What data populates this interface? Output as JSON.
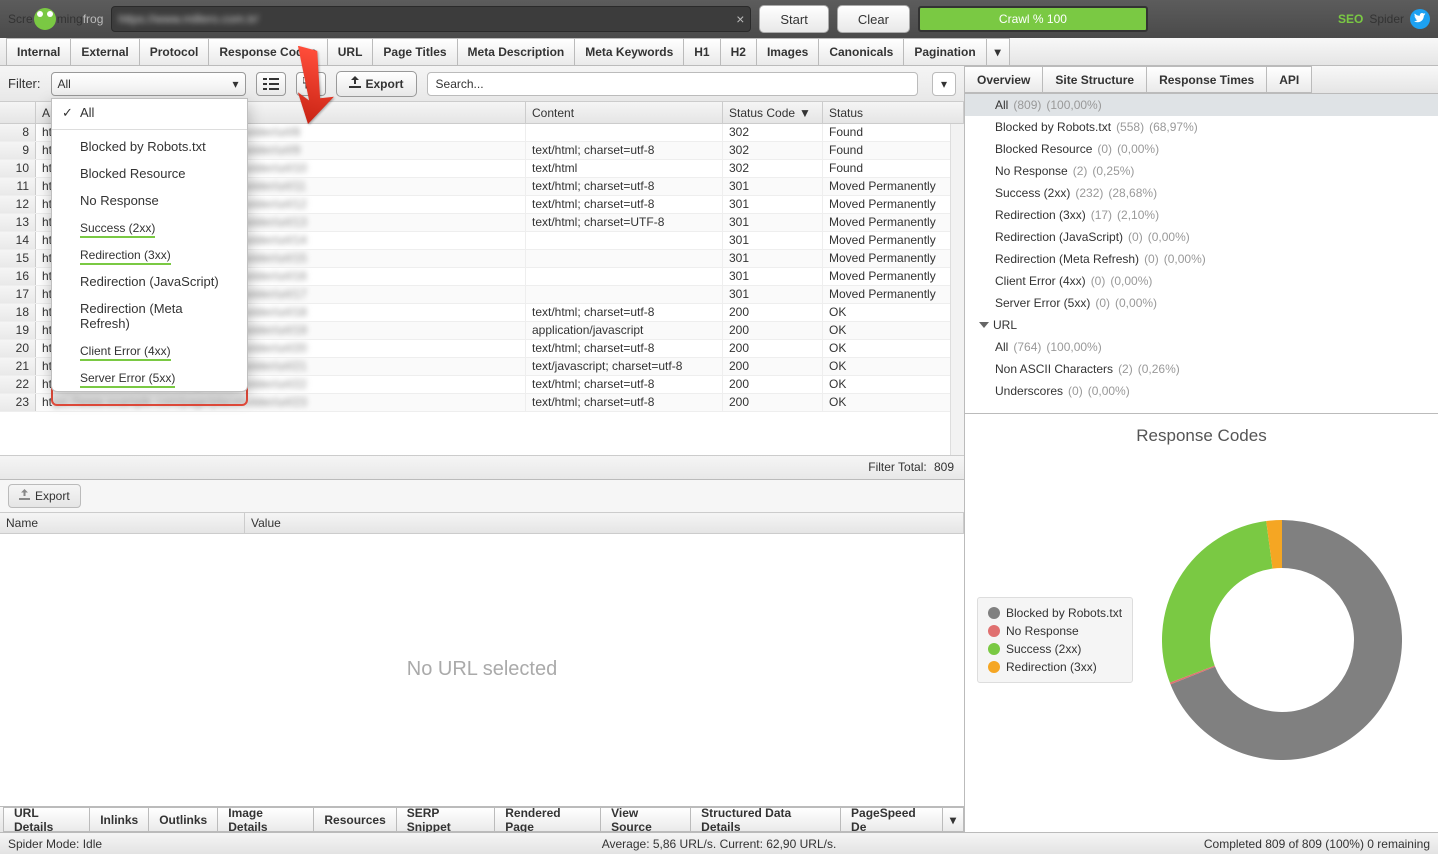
{
  "logo": {
    "pre": "Scre",
    "post": "ming",
    "tail": "frog"
  },
  "seo_spider": {
    "seo": "SEO",
    "spider": "Spider"
  },
  "url_input": {
    "value": "https://www.millero.com.tr/"
  },
  "top_buttons": {
    "start": "Start",
    "clear": "Clear"
  },
  "crawl_bar": "Crawl % 100",
  "main_tabs": [
    "Internal",
    "External",
    "Protocol",
    "Response Codes",
    "URL",
    "Page Titles",
    "Meta Description",
    "Meta Keywords",
    "H1",
    "H2",
    "Images",
    "Canonicals",
    "Pagination"
  ],
  "filter": {
    "label": "Filter:",
    "selected": "All",
    "export": "Export",
    "search_placeholder": "Search..."
  },
  "filter_options": [
    "All",
    "Blocked by Robots.txt",
    "Blocked Resource",
    "No Response",
    "Success (2xx)",
    "Redirection (3xx)",
    "Redirection (JavaScript)",
    "Redirection (Meta Refresh)",
    "Client Error (4xx)",
    "Server Error (5xx)"
  ],
  "filter_highlighted": [
    4,
    5,
    8,
    9
  ],
  "table": {
    "headers": {
      "addr": "A",
      "content": "Content",
      "status_code": "Status Code",
      "status": "Status"
    },
    "rows": [
      {
        "n": 8,
        "content": "",
        "code": "302",
        "status": "Found"
      },
      {
        "n": 9,
        "content": "text/html; charset=utf-8",
        "code": "302",
        "status": "Found"
      },
      {
        "n": 10,
        "content": "text/html",
        "code": "302",
        "status": "Found"
      },
      {
        "n": 11,
        "content": "text/html; charset=utf-8",
        "code": "301",
        "status": "Moved Permanently"
      },
      {
        "n": 12,
        "content": "text/html; charset=utf-8",
        "code": "301",
        "status": "Moved Permanently"
      },
      {
        "n": 13,
        "content": "text/html; charset=UTF-8",
        "code": "301",
        "status": "Moved Permanently"
      },
      {
        "n": 14,
        "content": "",
        "code": "301",
        "status": "Moved Permanently"
      },
      {
        "n": 15,
        "content": "",
        "code": "301",
        "status": "Moved Permanently"
      },
      {
        "n": 16,
        "content": "",
        "code": "301",
        "status": "Moved Permanently"
      },
      {
        "n": 17,
        "content": "",
        "code": "301",
        "status": "Moved Permanently"
      },
      {
        "n": 18,
        "content": "text/html; charset=utf-8",
        "code": "200",
        "status": "OK"
      },
      {
        "n": 19,
        "content": "application/javascript",
        "code": "200",
        "status": "OK"
      },
      {
        "n": 20,
        "content": "text/html; charset=utf-8",
        "code": "200",
        "status": "OK"
      },
      {
        "n": 21,
        "content": "text/javascript; charset=utf-8",
        "code": "200",
        "status": "OK"
      },
      {
        "n": 22,
        "content": "text/html; charset=utf-8",
        "code": "200",
        "status": "OK"
      },
      {
        "n": 23,
        "content": "text/html; charset=utf-8",
        "code": "200",
        "status": "OK"
      }
    ],
    "filter_total_label": "Filter Total:",
    "filter_total_value": "809"
  },
  "lower": {
    "export": "Export",
    "name": "Name",
    "value": "Value",
    "no_url": "No URL selected"
  },
  "bottom_tabs": [
    "URL Details",
    "Inlinks",
    "Outlinks",
    "Image Details",
    "Resources",
    "SERP Snippet",
    "Rendered Page",
    "View Source",
    "Structured Data Details",
    "PageSpeed De"
  ],
  "right_tabs": [
    "Overview",
    "Site Structure",
    "Response Times",
    "API"
  ],
  "overview": {
    "items": [
      {
        "label": "All",
        "count": "(809)",
        "pct": "(100,00%)",
        "selected": true
      },
      {
        "label": "Blocked by Robots.txt",
        "count": "(558)",
        "pct": "(68,97%)"
      },
      {
        "label": "Blocked Resource",
        "count": "(0)",
        "pct": "(0,00%)"
      },
      {
        "label": "No Response",
        "count": "(2)",
        "pct": "(0,25%)"
      },
      {
        "label": "Success (2xx)",
        "count": "(232)",
        "pct": "(28,68%)"
      },
      {
        "label": "Redirection (3xx)",
        "count": "(17)",
        "pct": "(2,10%)"
      },
      {
        "label": "Redirection (JavaScript)",
        "count": "(0)",
        "pct": "(0,00%)"
      },
      {
        "label": "Redirection (Meta Refresh)",
        "count": "(0)",
        "pct": "(0,00%)"
      },
      {
        "label": "Client Error (4xx)",
        "count": "(0)",
        "pct": "(0,00%)"
      },
      {
        "label": "Server Error (5xx)",
        "count": "(0)",
        "pct": "(0,00%)"
      }
    ],
    "url_header": "URL",
    "url_items": [
      {
        "label": "All",
        "count": "(764)",
        "pct": "(100,00%)"
      },
      {
        "label": "Non ASCII Characters",
        "count": "(2)",
        "pct": "(0,26%)"
      },
      {
        "label": "Underscores",
        "count": "(0)",
        "pct": "(0,00%)"
      }
    ]
  },
  "chart_data": {
    "type": "pie",
    "title": "Response Codes",
    "series": [
      {
        "name": "Blocked by Robots.txt",
        "value": 558,
        "color": "#808080"
      },
      {
        "name": "No Response",
        "value": 2,
        "color": "#e07070"
      },
      {
        "name": "Success (2xx)",
        "value": 232,
        "color": "#7ac943"
      },
      {
        "name": "Redirection (3xx)",
        "value": 17,
        "color": "#f5a623"
      }
    ]
  },
  "status": {
    "mode": "Spider Mode: Idle",
    "avg": "Average: 5,86 URL/s. Current: 62,90 URL/s.",
    "completed": "Completed 809 of 809 (100%) 0 remaining"
  }
}
